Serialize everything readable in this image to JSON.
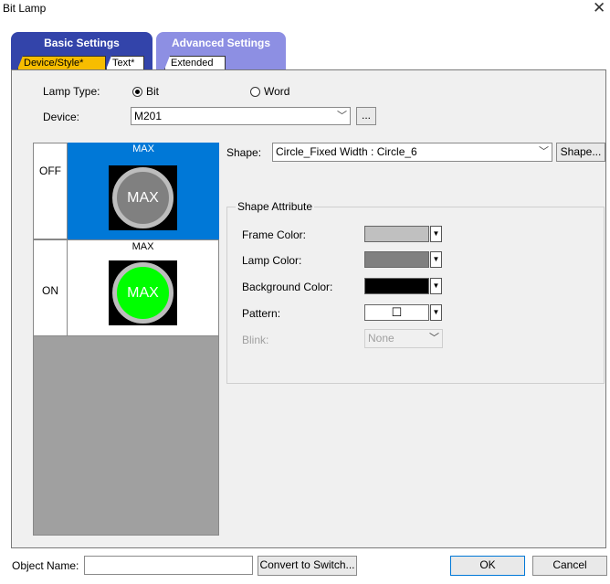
{
  "window": {
    "title": "Bit Lamp"
  },
  "tabs": {
    "basic_settings": "Basic Settings",
    "advanced_settings": "Advanced Settings",
    "device_style": "Device/Style*",
    "text": "Text*",
    "extended": "Extended"
  },
  "lamp_type": {
    "label": "Lamp Type:",
    "bit": "Bit",
    "word": "Word",
    "selected": "bit"
  },
  "device": {
    "label": "Device:",
    "value": "M201",
    "browse_label": "..."
  },
  "preview": {
    "off_label": "OFF",
    "on_label": "ON",
    "off_header": "MAX",
    "on_header": "MAX",
    "off_lamp_text": "MAX",
    "on_lamp_text": "MAX"
  },
  "shape": {
    "label": "Shape:",
    "value": "Circle_Fixed Width : Circle_6",
    "button_label": "Shape..."
  },
  "shape_attribute": {
    "legend": "Shape Attribute",
    "frame_color_label": "Frame Color:",
    "lamp_color_label": "Lamp Color:",
    "background_color_label": "Background Color:",
    "pattern_label": "Pattern:",
    "blink_label": "Blink:",
    "blink_value": "None",
    "frame_color": "#c0c0c0",
    "lamp_color": "#808080",
    "background_color": "#000000"
  },
  "footer": {
    "object_name_label": "Object Name:",
    "object_name_value": "",
    "convert_button": "Convert to Switch...",
    "ok_button": "OK",
    "cancel_button": "Cancel"
  },
  "colors": {
    "basic_tab": "#3344aa",
    "advanced_tab": "#8d8fe3",
    "active_subtab": "#f7bd00",
    "selected_state": "#0078d7",
    "on_lamp": "#00ff00",
    "off_lamp": "#808080"
  }
}
